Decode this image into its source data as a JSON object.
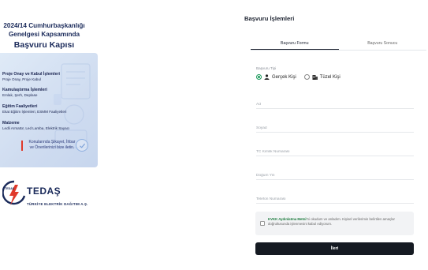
{
  "hero": {
    "line1": "2024/14 Cumhurbaşkanlığı",
    "line2": "Genelgesi Kapsamında",
    "line3": "Başvuru Kapısı"
  },
  "info_groups": [
    {
      "title": "Proje Onay ve Kabul İşlemleri",
      "subtitle": "Proje Onay, Proje Kabul"
    },
    {
      "title": "Kamulaştırma İşlemleri",
      "subtitle": "Emlak, Şerh, Deplase"
    },
    {
      "title": "Eğitim Faaliyetleri",
      "subtitle": "Ekat Eğitim İşlemleri, ESMM Faaliyetleri"
    },
    {
      "title": "Malzeme",
      "subtitle": "Ledli Armatür, Led Lamba, Elektrik Sayacı"
    }
  ],
  "highlight": {
    "line1": "Konularında  Şikayet, İhbar",
    "line2": "ve Önerilerinizi bize iletin."
  },
  "brand": {
    "logo_text": "TEDAŞ",
    "name": "TEDAŞ",
    "subtitle": "TÜRKİYE ELEKTRİK DAĞITIM A.Ş."
  },
  "colors": {
    "brand_red": "#e0392a",
    "accent_green": "#1b9a5b",
    "button_dark": "#151a22"
  },
  "page_title": "Başvuru İşlemleri",
  "tabs": [
    {
      "label": "Başvuru Formu",
      "active": true
    },
    {
      "label": "Başvuru Sonucu",
      "active": false
    }
  ],
  "form": {
    "type_label": "Başvuru Tipi",
    "options": [
      {
        "label": "Gerçek Kişi",
        "icon": "person-icon",
        "selected": true
      },
      {
        "label": "Tüzel Kişi",
        "icon": "building-icon",
        "selected": false
      }
    ],
    "fields": [
      {
        "key": "ad",
        "placeholder": "Ad",
        "value": ""
      },
      {
        "key": "soyad",
        "placeholder": "Soyad",
        "value": ""
      },
      {
        "key": "tckn",
        "placeholder": "TC Kimlik Numarası",
        "value": ""
      },
      {
        "key": "dogum",
        "placeholder": "Doğum Yılı",
        "value": ""
      },
      {
        "key": "telefon",
        "placeholder": "Telefon Numarası",
        "value": ""
      }
    ],
    "consent": {
      "link_text": "KVKK Aydınlatma Metni'",
      "text": "ni okudum ve anladım. Kişisel verilerimin belirtilen amaçlar doğrultusunda işlenmesini kabul ediyorum.",
      "checked": false
    },
    "submit_label": "İleri"
  }
}
